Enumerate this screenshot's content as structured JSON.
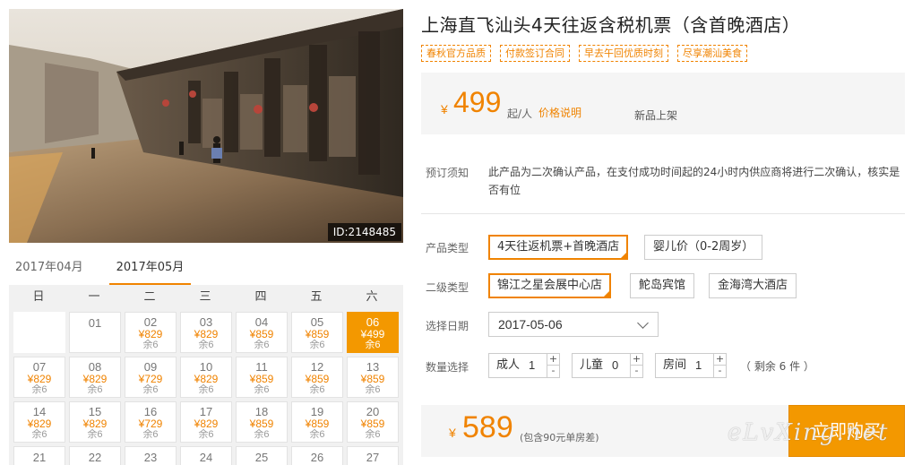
{
  "product": {
    "title": "上海直飞汕头4天往返含税机票（含首晚酒店）",
    "photo_id": "ID:2148485",
    "tags": [
      "春秋官方品质",
      "付款签订合同",
      "早去午回优质时刻",
      "尽享潮汕美食"
    ]
  },
  "price": {
    "currency": "¥",
    "amount": "499",
    "unit": "起/人",
    "explain_link": "价格说明",
    "new_label": "新品上架"
  },
  "notice": {
    "label": "预订须知",
    "text": "此产品为二次确认产品，在支付成功时间起的24小时内供应商将进行二次确认，核实是否有位"
  },
  "product_type": {
    "label": "产品类型",
    "options": [
      "4天往返机票+首晚酒店",
      "婴儿价（0-2周岁）"
    ],
    "selected": 0
  },
  "secondary_type": {
    "label": "二级类型",
    "options": [
      "锦江之星会展中心店",
      "鮀岛宾馆",
      "金海湾大酒店"
    ],
    "selected": 0
  },
  "date": {
    "label": "选择日期",
    "value": "2017-05-06"
  },
  "quantity": {
    "label": "数量选择",
    "adult_label": "成人",
    "adult_value": "1",
    "child_label": "儿童",
    "child_value": "0",
    "room_label": "房间",
    "room_value": "1",
    "remaining": "（ 剩余 6 件 ）",
    "plus": "+",
    "minus": "-"
  },
  "total": {
    "currency": "¥",
    "amount": "589",
    "note": "(包含90元单房差)"
  },
  "buy_button": "立即购买",
  "watermark": "eLvXing.net",
  "calendar": {
    "tabs": [
      "2017年04月",
      "2017年05月"
    ],
    "active_tab": 1,
    "weekdays": [
      "日",
      "一",
      "二",
      "三",
      "四",
      "五",
      "六"
    ],
    "days": [
      {
        "d": "",
        "p": "",
        "s": ""
      },
      {
        "d": "01",
        "p": "",
        "s": ""
      },
      {
        "d": "02",
        "p": "¥829",
        "s": "余6"
      },
      {
        "d": "03",
        "p": "¥829",
        "s": "余6"
      },
      {
        "d": "04",
        "p": "¥859",
        "s": "余6"
      },
      {
        "d": "05",
        "p": "¥859",
        "s": "余6"
      },
      {
        "d": "06",
        "p": "¥499",
        "s": "余6",
        "selected": true
      },
      {
        "d": "07",
        "p": "¥829",
        "s": "余6"
      },
      {
        "d": "08",
        "p": "¥829",
        "s": "余6"
      },
      {
        "d": "09",
        "p": "¥729",
        "s": "余6"
      },
      {
        "d": "10",
        "p": "¥829",
        "s": "余6"
      },
      {
        "d": "11",
        "p": "¥859",
        "s": "余6"
      },
      {
        "d": "12",
        "p": "¥859",
        "s": "余6"
      },
      {
        "d": "13",
        "p": "¥859",
        "s": "余6"
      },
      {
        "d": "14",
        "p": "¥829",
        "s": "余6"
      },
      {
        "d": "15",
        "p": "¥829",
        "s": "余6"
      },
      {
        "d": "16",
        "p": "¥729",
        "s": "余6"
      },
      {
        "d": "17",
        "p": "¥829",
        "s": "余6"
      },
      {
        "d": "18",
        "p": "¥859",
        "s": "余6"
      },
      {
        "d": "19",
        "p": "¥859",
        "s": "余6"
      },
      {
        "d": "20",
        "p": "¥859",
        "s": "余6"
      },
      {
        "d": "21",
        "p": "",
        "s": ""
      },
      {
        "d": "22",
        "p": "",
        "s": ""
      },
      {
        "d": "23",
        "p": "",
        "s": ""
      },
      {
        "d": "24",
        "p": "",
        "s": ""
      },
      {
        "d": "25",
        "p": "",
        "s": ""
      },
      {
        "d": "26",
        "p": "",
        "s": ""
      },
      {
        "d": "27",
        "p": "",
        "s": ""
      }
    ]
  }
}
